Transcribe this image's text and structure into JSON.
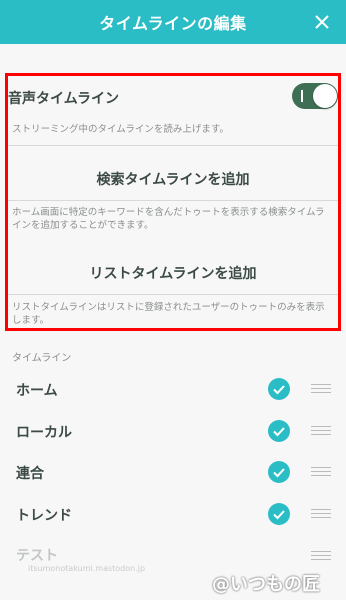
{
  "header": {
    "title": "タイムラインの編集"
  },
  "voice": {
    "label": "音声タイムライン",
    "toggle_on": true,
    "description": "ストリーミング中のタイムラインを読み上げます。"
  },
  "search_timeline": {
    "button_label": "検索タイムラインを追加",
    "description": "ホーム画面に特定のキーワードを含んだトゥートを表示する検索タイムラインを追加することができます。"
  },
  "list_timeline": {
    "button_label": "リストタイムラインを追加",
    "description": "リストタイムラインはリストに登録されたユーザーのトゥートのみを表示します。"
  },
  "timelines": {
    "section_label": "タイムライン",
    "items": [
      {
        "label": "ホーム",
        "checked": true
      },
      {
        "label": "ローカル",
        "checked": true
      },
      {
        "label": "連合",
        "checked": true
      },
      {
        "label": "トレンド",
        "checked": true
      },
      {
        "label": "テスト",
        "checked": false,
        "subtitle": "itsumonotakumi.mastodon.jp"
      }
    ]
  },
  "watermark": "@いつもの匠",
  "colors": {
    "accent": "#2bbdc6",
    "toggle": "#3e6f55",
    "highlight_border": "#ff0000"
  }
}
